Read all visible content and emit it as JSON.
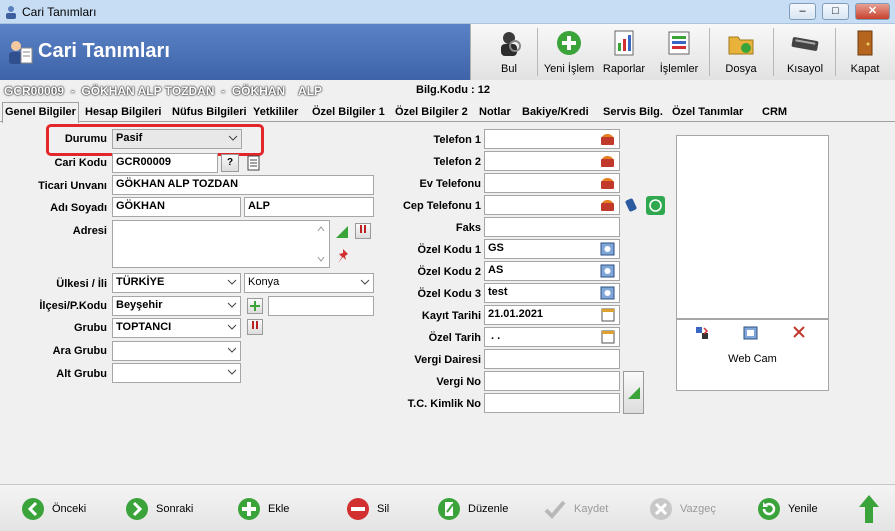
{
  "window": {
    "title": "Cari Tanımları",
    "minimize": "–",
    "maximize": "□",
    "close": "✕"
  },
  "header": {
    "title": "Cari Tanımları"
  },
  "toolbar": [
    {
      "label": "Bul",
      "icon": "search-person-icon"
    },
    {
      "label": "Yeni İşlem",
      "icon": "add-circle-icon"
    },
    {
      "label": "Raporlar",
      "icon": "report-icon"
    },
    {
      "label": "İşlemler",
      "icon": "transactions-icon"
    },
    {
      "label": "Dosya",
      "icon": "folder-icon"
    },
    {
      "label": "Kısayol",
      "icon": "keyboard-icon"
    },
    {
      "label": "Kapat",
      "icon": "exit-door-icon"
    }
  ],
  "info": {
    "code_line": "GCR00009  -  GÖKHAN ALP TOZDAN  -  GÖKHAN    ALP",
    "bilg_kodu": "Bilg.Kodu : 12"
  },
  "tabs": [
    "Genel Bilgiler",
    "Hesap Bilgileri",
    "Nüfus Bilgileri",
    "Yetkililer",
    "Özel Bilgiler 1",
    "Özel Bilgiler 2",
    "Notlar",
    "Bakiye/Kredi",
    "Servis Bilg.",
    "Özel Tanımlar",
    "CRM"
  ],
  "form_left": {
    "durumu": {
      "label": "Durumu",
      "value": "Pasif"
    },
    "cari_kodu": {
      "label": "Cari Kodu",
      "value": "GCR00009",
      "help": "?"
    },
    "ticari_unvani": {
      "label": "Ticari Unvanı",
      "value": "GÖKHAN ALP TOZDAN"
    },
    "adi_soyadi": {
      "label": "Adı Soyadı",
      "first": "GÖKHAN",
      "last": "ALP"
    },
    "adresi": {
      "label": "Adresi",
      "value": ""
    },
    "ulke_il": {
      "label": "Ülkesi / İli",
      "country": "TÜRKİYE",
      "city": "Konya"
    },
    "ilce_pkodu": {
      "label": "İlçesi/P.Kodu",
      "district": "Beyşehir",
      "postal": ""
    },
    "grubu": {
      "label": "Grubu",
      "value": "TOPTANCI"
    },
    "ara_grubu": {
      "label": "Ara Grubu",
      "value": ""
    },
    "alt_grubu": {
      "label": "Alt Grubu",
      "value": ""
    }
  },
  "form_right": {
    "telefon1": {
      "label": "Telefon 1",
      "value": ""
    },
    "telefon2": {
      "label": "Telefon 2",
      "value": ""
    },
    "ev_telefonu": {
      "label": "Ev Telefonu",
      "value": ""
    },
    "cep_telefonu1": {
      "label": "Cep Telefonu 1",
      "value": ""
    },
    "faks": {
      "label": "Faks",
      "value": ""
    },
    "ozel_kodu1": {
      "label": "Özel Kodu 1",
      "value": "GS"
    },
    "ozel_kodu2": {
      "label": "Özel Kodu 2",
      "value": "AS"
    },
    "ozel_kodu3": {
      "label": "Özel Kodu 3",
      "value": "test"
    },
    "kayit_tarihi": {
      "label": "Kayıt Tarihi",
      "value": "21.01.2021"
    },
    "ozel_tarih": {
      "label": "Özel Tarih",
      "value": " . ."
    },
    "vergi_dairesi": {
      "label": "Vergi Dairesi",
      "value": ""
    },
    "vergi_no": {
      "label": "Vergi No",
      "value": ""
    },
    "tc_kimlik_no": {
      "label": "T.C. Kimlik No",
      "value": ""
    }
  },
  "webcam": {
    "label": "Web Cam"
  },
  "bottom": [
    {
      "label": "Önceki",
      "enabled": true
    },
    {
      "label": "Sonraki",
      "enabled": true
    },
    {
      "label": "Ekle",
      "enabled": true
    },
    {
      "label": "Sil",
      "enabled": true
    },
    {
      "label": "Düzenle",
      "enabled": true
    },
    {
      "label": "Kaydet",
      "enabled": false
    },
    {
      "label": "Vazgeç",
      "enabled": false
    },
    {
      "label": "Yenile",
      "enabled": true
    }
  ],
  "colors": {
    "header": "#4a70b6",
    "highlight_box": "#e3262a",
    "green": "#3aa33a",
    "red": "#d23030"
  }
}
